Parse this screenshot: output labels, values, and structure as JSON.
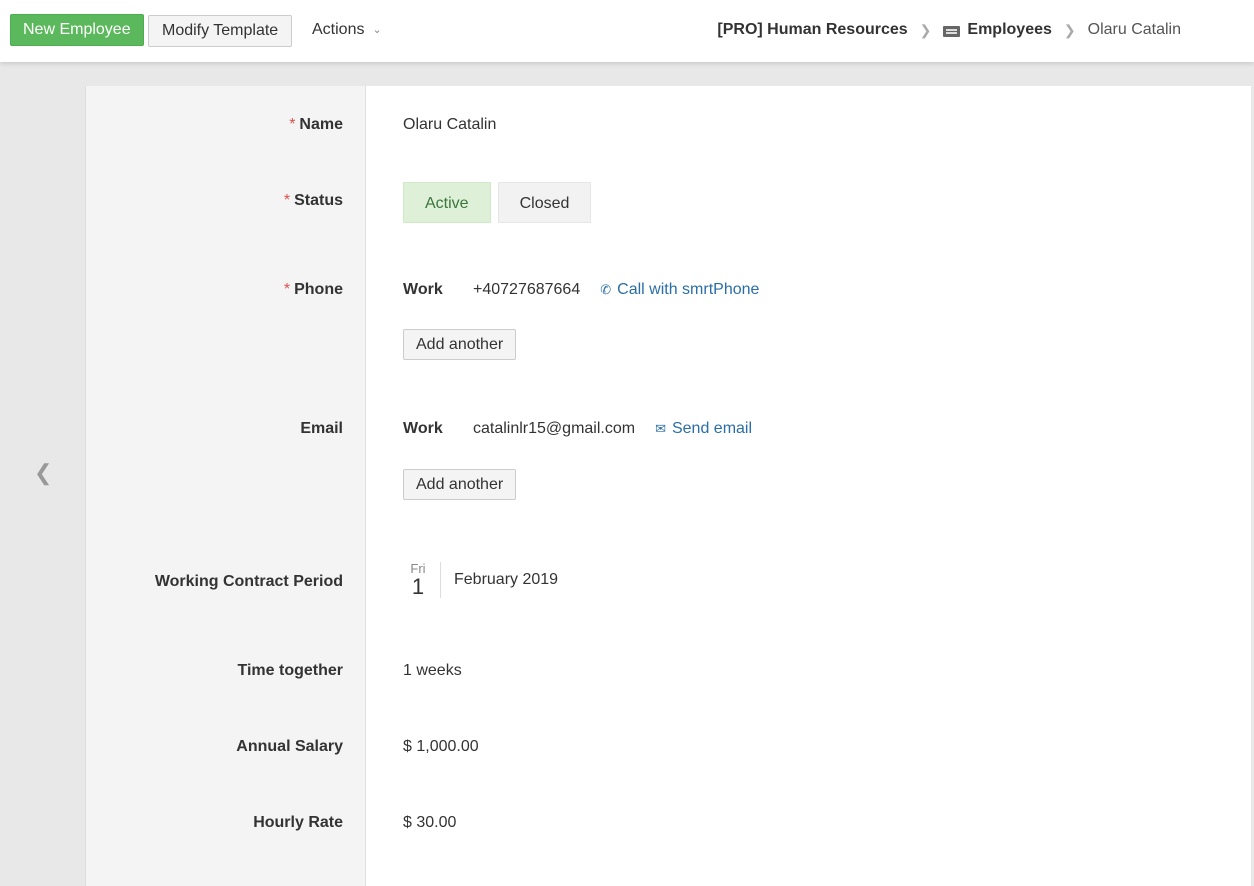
{
  "toolbar": {
    "new_label": "New Employee",
    "modify_label": "Modify Template",
    "actions_label": "Actions"
  },
  "breadcrumb": {
    "app": "[PRO] Human Resources",
    "section": "Employees",
    "current": "Olaru Catalin"
  },
  "form": {
    "name_label": "Name",
    "name_value": "Olaru Catalin",
    "status_label": "Status",
    "status_options": [
      "Active",
      "Closed"
    ],
    "status_selected": "Active",
    "phone_label": "Phone",
    "phone_kind": "Work",
    "phone_value": "+40727687664",
    "phone_action": "Call with smrtPhone",
    "phone_add": "Add another",
    "email_label": "Email",
    "email_kind": "Work",
    "email_value": "catalinlr15@gmail.com",
    "email_action": "Send email",
    "email_add": "Add another",
    "contract_label": "Working Contract Period",
    "contract_dow": "Fri",
    "contract_day": "1",
    "contract_month": "February 2019",
    "time_label": "Time together",
    "time_value": "1 weeks",
    "salary_label": "Annual Salary",
    "salary_value": "$ 1,000.00",
    "hourly_label": "Hourly Rate",
    "hourly_value": "$ 30.00"
  },
  "icons": {
    "required": "*",
    "phone": "phone-icon",
    "email": "envelope-open-icon",
    "employees": "id-card-icon",
    "nav_back": "chevron-left-icon"
  },
  "colors": {
    "primary": "#5cb85c",
    "active_bg": "#dff0d8",
    "active_text": "#3c763d",
    "link": "#2a6ea6",
    "required": "#d9534f"
  }
}
